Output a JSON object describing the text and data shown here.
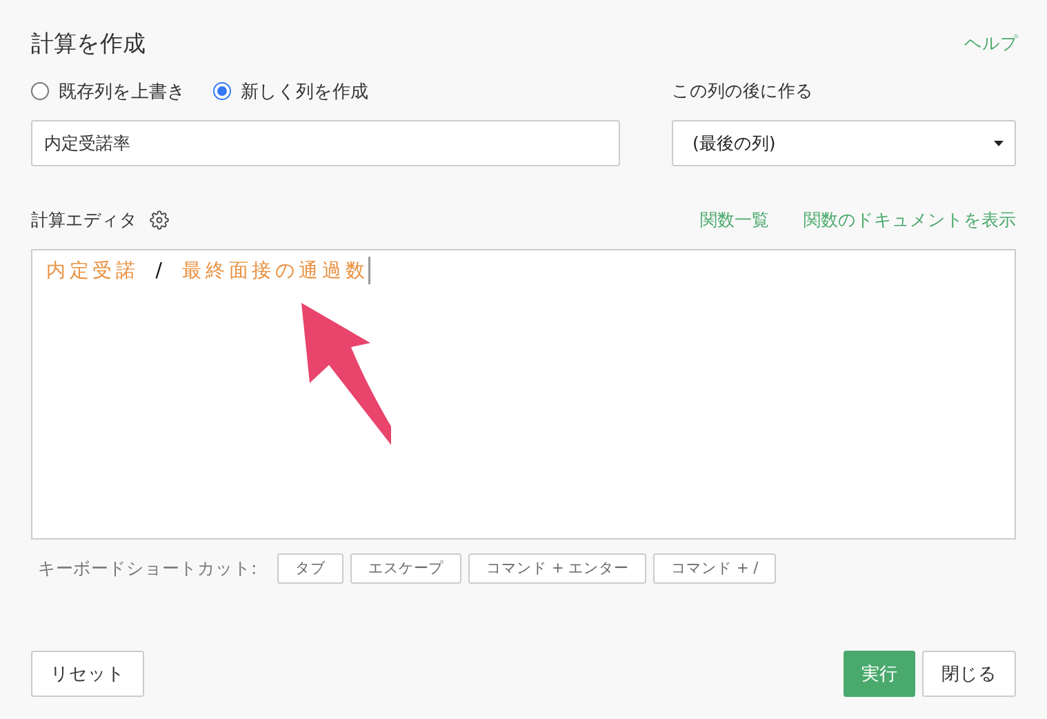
{
  "dialog": {
    "title": "計算を作成",
    "help_link": "ヘルプ"
  },
  "column_mode": {
    "options": [
      {
        "label": "既存列を上書き",
        "selected": false
      },
      {
        "label": "新しく列を作成",
        "selected": true
      }
    ]
  },
  "column_name": {
    "value": "内定受諾率"
  },
  "insert_after": {
    "label": "この列の後に作る",
    "value": "(最後の列)"
  },
  "editor": {
    "label": "計算エディタ",
    "links": [
      "関数一覧",
      "関数のドキュメントを表示"
    ],
    "tokens": [
      {
        "kind": "column",
        "text": "内定受諾"
      },
      {
        "kind": "operator",
        "text": "/"
      },
      {
        "kind": "column",
        "text": "最終面接の通過数"
      }
    ]
  },
  "shortcuts": {
    "label": "キーボードショートカット:",
    "keys": [
      "タブ",
      "エスケープ",
      "コマンド + エンター",
      "コマンド + /"
    ]
  },
  "buttons": {
    "reset": "リセット",
    "run": "実行",
    "close": "閉じる"
  }
}
